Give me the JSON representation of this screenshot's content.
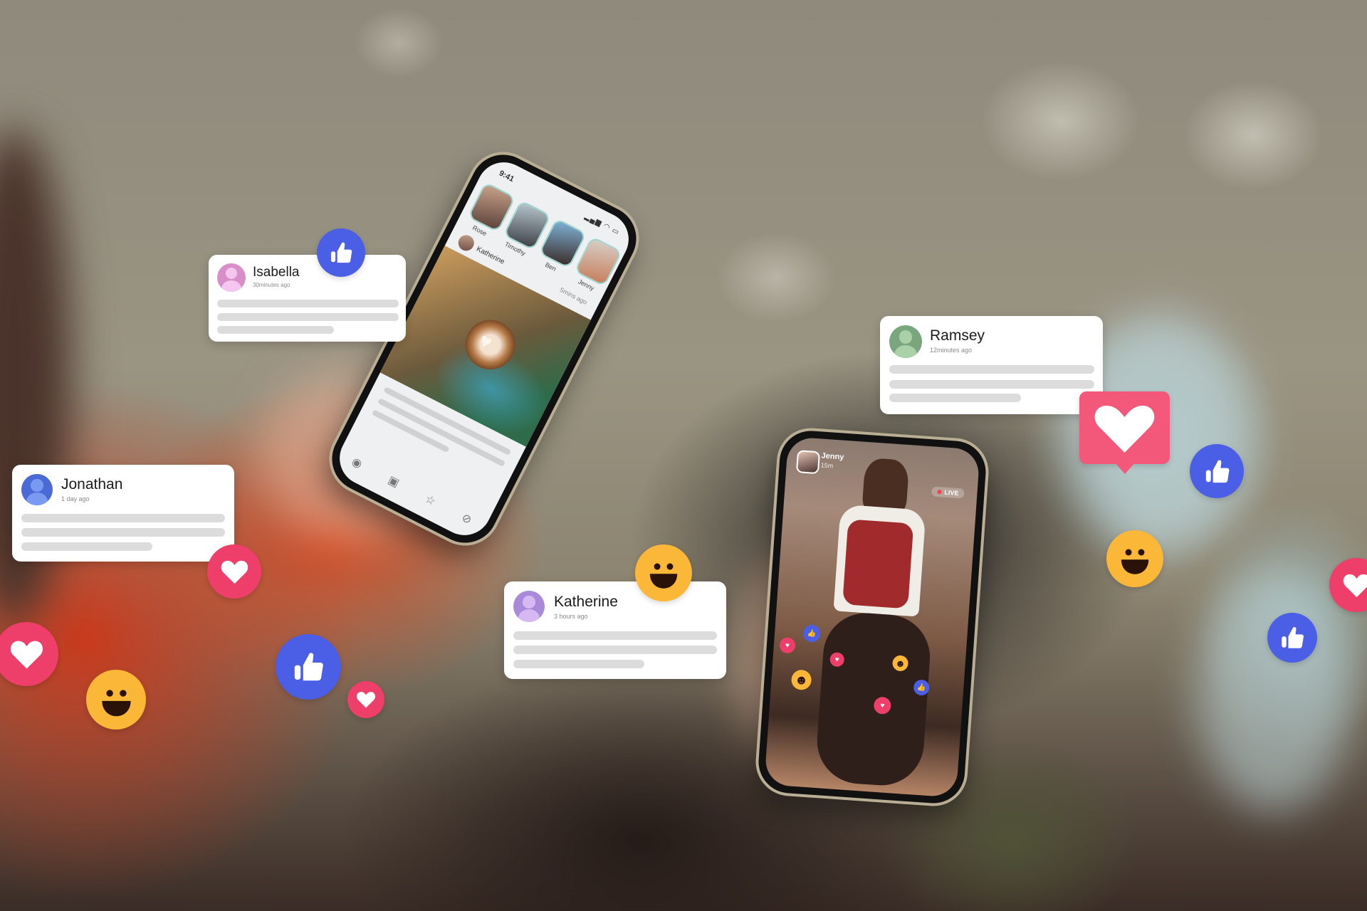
{
  "scene": {
    "description": "Two people holding smartphones with floating social media notification cards and reaction icons"
  },
  "colors": {
    "heart": "#ee3e6a",
    "like": "#4a5fe6",
    "smiley": "#fbb838",
    "smiley_feature": "#2a1208",
    "card_bg": "#ffffff",
    "placeholder_line": "#dcdcdc",
    "avatar_isabella": "#d88fc9",
    "avatar_ramsey": "#7aa67e",
    "avatar_jonathan": "#4a6ad6",
    "avatar_katherine": "#a98ad9"
  },
  "cards": [
    {
      "id": "isabella",
      "name": "Isabella",
      "time": "30minutes ago"
    },
    {
      "id": "ramsey",
      "name": "Ramsey",
      "time": "12minutes ago"
    },
    {
      "id": "jonathan",
      "name": "Jonathan",
      "time": "1 day ago"
    },
    {
      "id": "katherine",
      "name": "Katherine",
      "time": "3 hours ago"
    }
  ],
  "left_phone": {
    "status_time": "9:41",
    "status_icons": "▂▄▆ ◠ ▭",
    "stories": [
      "Rose",
      "Timothy",
      "Ben",
      "Jenny"
    ],
    "post_author": "Katherine",
    "post_time": "5mins ago",
    "tabs": [
      "home-icon",
      "bag-icon",
      "star-icon",
      "profile-icon"
    ],
    "tab_glyphs": [
      "◉",
      "▣",
      "☆",
      "⊘"
    ]
  },
  "right_phone": {
    "streamer": "Jenny",
    "elapsed": "15m",
    "live_label": "LIVE"
  },
  "glyphs": {
    "heart": "♥",
    "like": "👍",
    "smile": "☻"
  }
}
